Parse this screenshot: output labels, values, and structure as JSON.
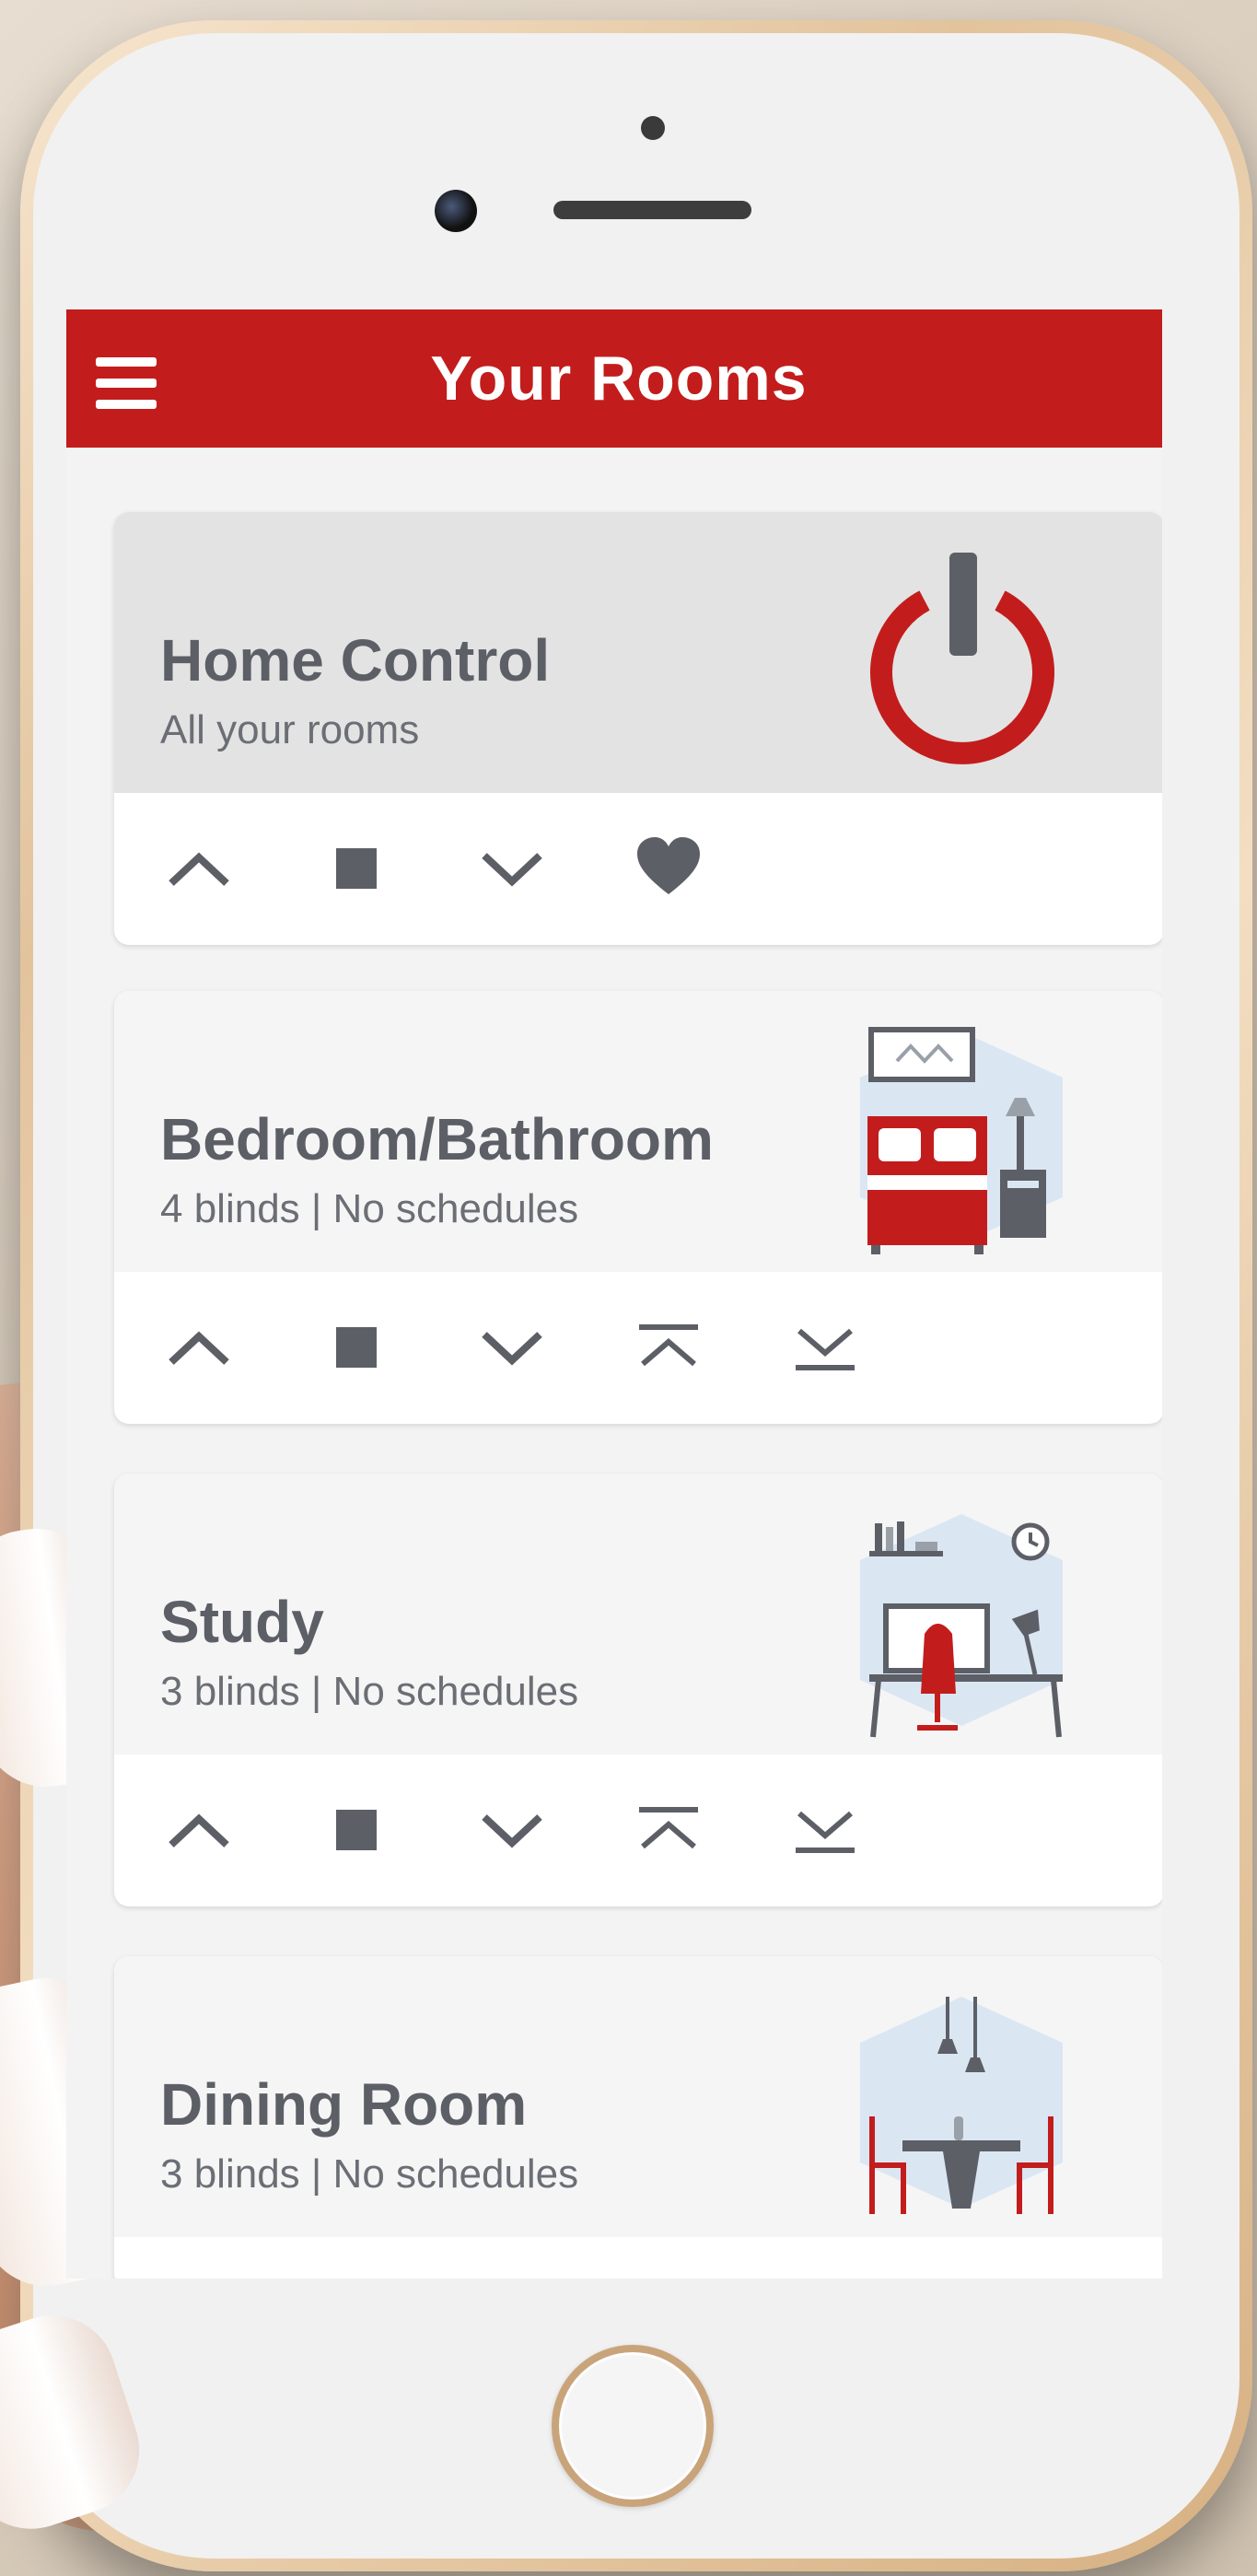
{
  "header": {
    "title": "Your Rooms"
  },
  "rooms": [
    {
      "title": "Home Control",
      "subtitle": "All your rooms"
    },
    {
      "title": "Bedroom/Bathroom",
      "subtitle": "4 blinds | No schedules"
    },
    {
      "title": "Study",
      "subtitle": "3 blinds | No schedules"
    },
    {
      "title": "Dining Room",
      "subtitle": "3 blinds | No schedules"
    }
  ],
  "colors": {
    "brand_red": "#c21d1c",
    "icon_gray": "#5c5f66",
    "card_bg": "#f5f5f5",
    "hero_bg": "#e3e3e3"
  },
  "icons": {
    "menu": "hamburger-icon",
    "power": "power-icon",
    "up": "chevron-up-icon",
    "stop": "stop-icon",
    "down": "chevron-down-icon",
    "favorite": "heart-icon",
    "fully_up": "fully-open-icon",
    "fully_down": "fully-close-icon"
  }
}
